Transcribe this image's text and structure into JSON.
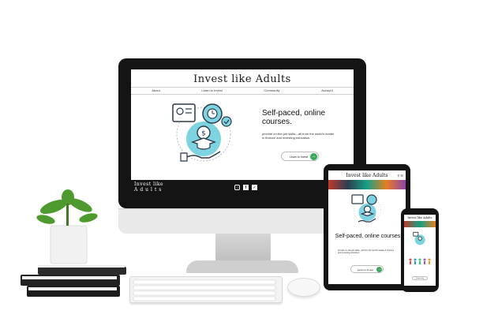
{
  "site": {
    "title": "Invest like Adults",
    "footer_logo_line1": "Invest like",
    "footer_logo_line2": "Adults"
  },
  "nav": {
    "items": [
      "About",
      "Learn to Invest",
      "Community",
      "Account"
    ]
  },
  "hero": {
    "heading": "Self-paced, online courses.",
    "subtext": "provide on-the-job skills—all from the world's leader in finance and investing education.",
    "button_label": "Learn to Invest",
    "button_icon": "arrow-right-icon"
  },
  "footer": {
    "social_icons": [
      "instagram-icon",
      "facebook-icon",
      "twitter-icon"
    ]
  },
  "tablet": {
    "title": "Invest like Adults",
    "heading": "Self-paced, online courses.",
    "subtext": "provide on-the-job skills—all from the world's leader in finance and investing education.",
    "button_label": "Learn to Invest"
  },
  "phone": {
    "title": "Invest like Adults",
    "button_label": "Community"
  },
  "colors": {
    "accent": "#3aa85a",
    "illustration": "#7ed3e0",
    "dark": "#141414"
  }
}
